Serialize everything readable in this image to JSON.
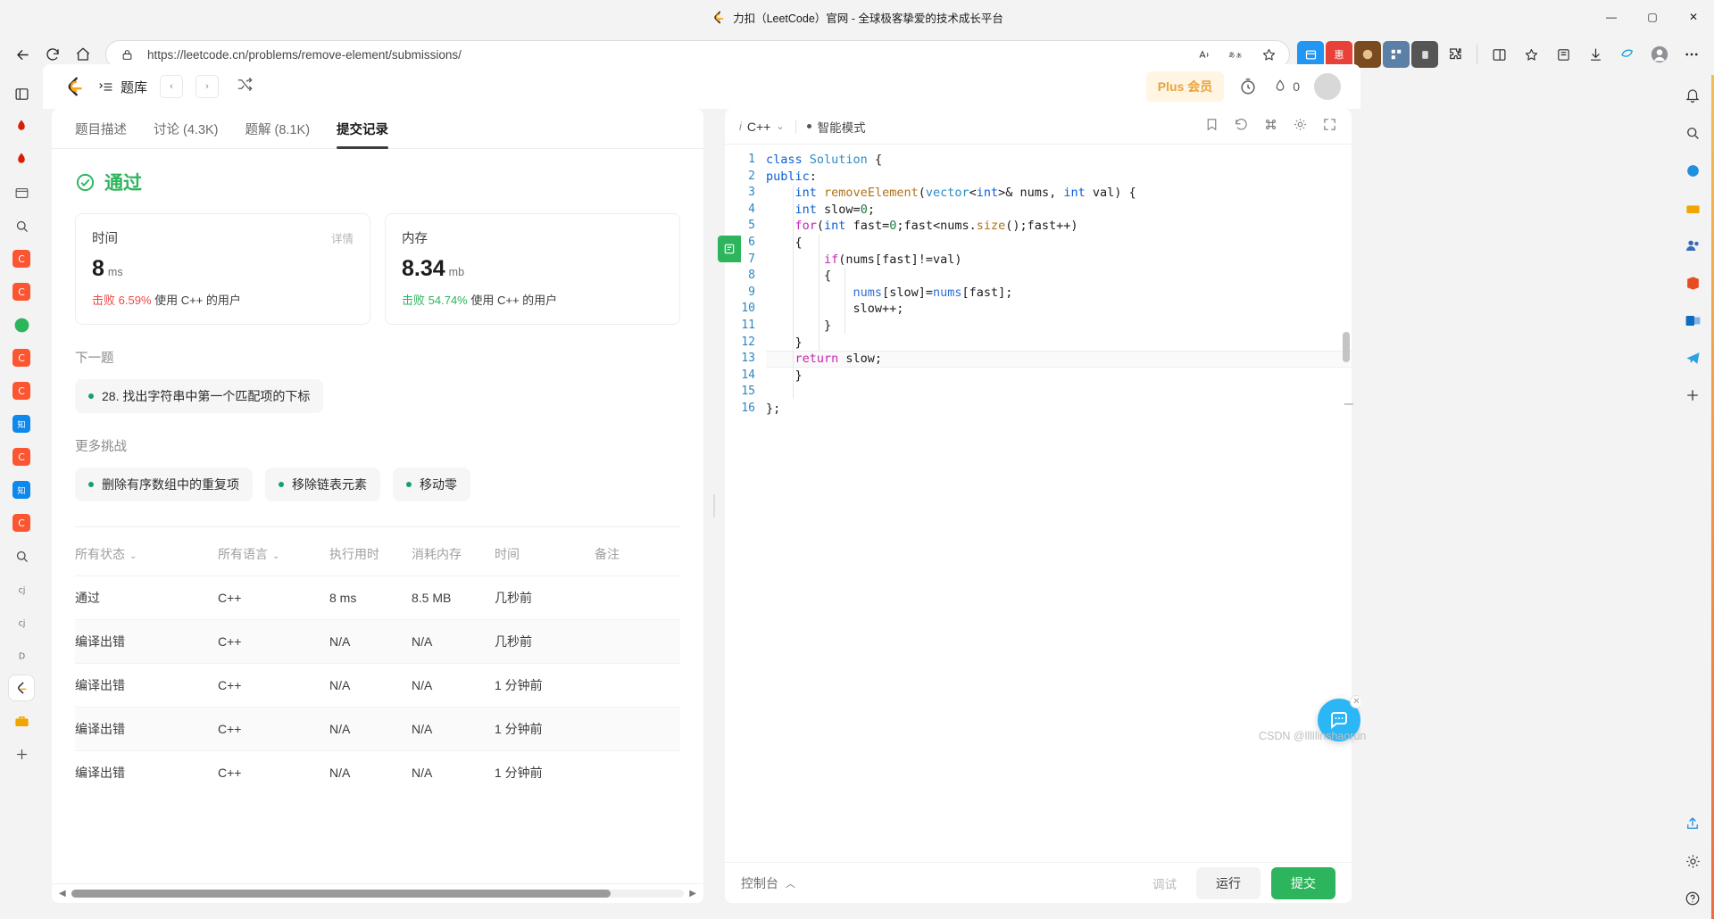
{
  "browser": {
    "window_title": "力扣（LeetCode）官网 - 全球极客挚爱的技术成长平台",
    "url": "https://leetcode.cn/problems/remove-element/submissions/",
    "nav": {
      "back_icon": "back-arrow-icon",
      "refresh_icon": "refresh-icon",
      "home_icon": "home-icon",
      "lock_icon": "site-info-lock-icon",
      "read_aloud_icon": "read-aloud-icon",
      "translate_icon": "translate-icon",
      "favorite_icon": "add-favorite-star-icon"
    },
    "window_controls": {
      "minimize": "—",
      "maximize": "▢",
      "close": "✕"
    },
    "extensions": [
      "collections-icon",
      "extension-red-icon",
      "extension-badge-icon",
      "extension-grid-icon",
      "extension-dark-icon",
      "puzzle-icon",
      "split-screen-icon",
      "favorites-icon",
      "collections-bar-icon",
      "downloads-icon",
      "browser-essentials-icon",
      "profile-icon",
      "settings-more-icon"
    ]
  },
  "site": {
    "nav": {
      "logo": "leetcode-logo",
      "problem_list_label": "题库",
      "prev_label": "‹",
      "next_label": "›",
      "shuffle_icon": "shuffle-icon",
      "plus_label": "Plus 会员",
      "timer_icon": "timer-icon",
      "streak_icon": "streak-fire-icon",
      "streak_count": "0",
      "avatar": "user-avatar"
    },
    "tabs": [
      {
        "label": "题目描述",
        "active": false
      },
      {
        "label": "讨论 (4.3K)",
        "active": false
      },
      {
        "label": "题解 (8.1K)",
        "active": false
      },
      {
        "label": "提交记录",
        "active": true
      }
    ],
    "result": {
      "verdict": "通过",
      "cards": [
        {
          "title": "时间",
          "link": "详情",
          "value": "8",
          "unit": "ms",
          "beat_label": "击败",
          "beat_percent": "6.59%",
          "beat_suffix": "使用 C++ 的用户",
          "beat_color": "#ef4743"
        },
        {
          "title": "内存",
          "link": "",
          "value": "8.34",
          "unit": "mb",
          "beat_label": "击败",
          "beat_percent": "54.74%",
          "beat_suffix": "使用 C++ 的用户",
          "beat_color": "#2db55d"
        }
      ],
      "next_problem_title": "下一题",
      "next_problem": "28. 找出字符串中第一个匹配项的下标",
      "more_challenges_title": "更多挑战",
      "more_challenges": [
        "删除有序数组中的重复项",
        "移除链表元素",
        "移动零"
      ]
    },
    "table": {
      "headers": [
        "所有状态",
        "所有语言",
        "执行用时",
        "消耗内存",
        "时间",
        "备注"
      ],
      "header_has_caret": [
        true,
        true,
        false,
        false,
        false,
        false
      ],
      "rows": [
        {
          "status": "通过",
          "status_type": "pass",
          "lang": "C++",
          "runtime": "8 ms",
          "memory": "8.5 MB",
          "when": "几秒前",
          "note": ""
        },
        {
          "status": "编译出错",
          "status_type": "error",
          "lang": "C++",
          "runtime": "N/A",
          "memory": "N/A",
          "when": "几秒前",
          "note": ""
        },
        {
          "status": "编译出错",
          "status_type": "error",
          "lang": "C++",
          "runtime": "N/A",
          "memory": "N/A",
          "when": "1 分钟前",
          "note": ""
        },
        {
          "status": "编译出错",
          "status_type": "error",
          "lang": "C++",
          "runtime": "N/A",
          "memory": "N/A",
          "when": "1 分钟前",
          "note": ""
        },
        {
          "status": "编译出错",
          "status_type": "error",
          "lang": "C++",
          "runtime": "N/A",
          "memory": "N/A",
          "when": "1 分钟前",
          "note": ""
        }
      ]
    },
    "editor": {
      "lang": "C++",
      "lang_info_icon": "info-italic-icon",
      "lang_caret": "chevron-down-icon",
      "mode": "智能模式",
      "toolbar_icons": [
        "bookmark-icon",
        "reset-history-icon",
        "shortcuts-icon",
        "settings-gear-icon",
        "fullscreen-icon"
      ],
      "highlight_line": 13,
      "lines": [
        {
          "n": 1,
          "code": "class Solution {"
        },
        {
          "n": 2,
          "code": "public:"
        },
        {
          "n": 3,
          "code": "    int removeElement(vector<int>& nums, int val) {"
        },
        {
          "n": 4,
          "code": "    int slow=0;"
        },
        {
          "n": 5,
          "code": "    for(int fast=0;fast<nums.size();fast++)"
        },
        {
          "n": 6,
          "code": "    {"
        },
        {
          "n": 7,
          "code": "        if(nums[fast]!=val)"
        },
        {
          "n": 8,
          "code": "        {"
        },
        {
          "n": 9,
          "code": "            nums[slow]=nums[fast];"
        },
        {
          "n": 10,
          "code": "            slow++;"
        },
        {
          "n": 11,
          "code": "        }"
        },
        {
          "n": 12,
          "code": "    }"
        },
        {
          "n": 13,
          "code": "    return slow;"
        },
        {
          "n": 14,
          "code": "    }"
        },
        {
          "n": 15,
          "code": ""
        },
        {
          "n": 16,
          "code": "};"
        }
      ]
    },
    "console": {
      "label": "控制台",
      "collapse_icon": "chevron-up-icon",
      "debug_label": "调试",
      "run_label": "运行",
      "submit_label": "提交"
    },
    "watermark": "CSDN @lllllinshaorun"
  },
  "colors": {
    "accent_green": "#2db55d",
    "error_red": "#ef4743",
    "plus_gold": "#e8a33d",
    "code_keyword": "#c724b1",
    "code_type": "#2b8cc4"
  }
}
